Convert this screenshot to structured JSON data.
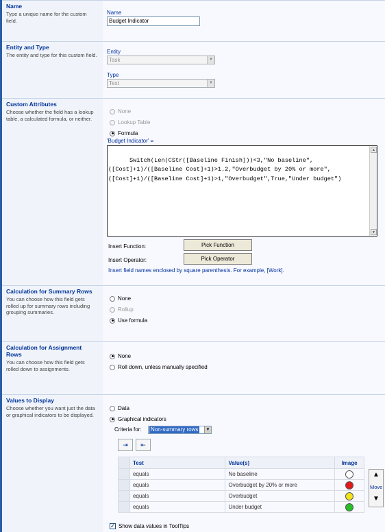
{
  "sections": {
    "name": {
      "title": "Name",
      "desc": "Type a unique name for the custom field."
    },
    "entity": {
      "title": "Entity and Type",
      "desc": "The entity and type for this custom field."
    },
    "custom": {
      "title": "Custom Attributes",
      "desc": "Choose whether the field has a lookup table, a calculated formula, or neither."
    },
    "summary": {
      "title": "Calculation for Summary Rows",
      "desc": "You can choose how this field gets rolled up for summary rows including grouping summaries."
    },
    "assignment": {
      "title": "Calculation for Assignment Rows",
      "desc": "You can choose how this field gets rolled down to assignments."
    },
    "display": {
      "title": "Values to Display",
      "desc": "Choose whether you want just the data or graphical indicators to be displayed."
    }
  },
  "name_field": {
    "label": "Name",
    "value": "Budget Indicator"
  },
  "entity_field": {
    "label": "Entity",
    "value": "Task"
  },
  "type_field": {
    "label": "Type",
    "value": "Text"
  },
  "custom_attrs": {
    "opt_none": "None",
    "opt_lookup": "Lookup Table",
    "opt_formula": "Formula",
    "formula_label": "'Budget Indicator' =",
    "formula_text": "Switch(Len(CStr([Baseline Finish]))<3,\"No baseline\",([Cost]+1)/([Baseline Cost]+1)>1.2,\"Overbudget by 20% or more\",([Cost]+1)/([Baseline Cost]+1)>1,\"Overbudget\",True,\"Under budget\")",
    "insert_function_label": "Insert Function:",
    "pick_function": "Pick Function",
    "insert_operator_label": "Insert Operator:",
    "pick_operator": "Pick Operator",
    "hint": "Insert field names enclosed by square parenthesis. For example, [Work]."
  },
  "summary_rows": {
    "opt_none": "None",
    "opt_rollup": "Rollup",
    "opt_formula": "Use formula"
  },
  "assignment_rows": {
    "opt_none": "None",
    "opt_rolldown": "Roll down, unless manually specified"
  },
  "values_display": {
    "opt_data": "Data",
    "opt_graphical": "Graphical indicators",
    "criteria_label": "Criteria for:",
    "criteria_value": "Non-summary rows",
    "headers": {
      "test": "Test",
      "values": "Value(s)",
      "image": "Image"
    },
    "rows": [
      {
        "test": "equals",
        "value": "No baseline",
        "color": "#ffffff"
      },
      {
        "test": "equals",
        "value": "Overbudget by 20% or more",
        "color": "#e11a1a"
      },
      {
        "test": "equals",
        "value": "Overbudget",
        "color": "#f2e31a"
      },
      {
        "test": "equals",
        "value": "Under budget",
        "color": "#26c026"
      }
    ],
    "move_label": "Move",
    "show_tooltips": "Show data values in ToolTips"
  },
  "colors": {
    "accent": "#003399",
    "panel": "#f0f4fa"
  }
}
